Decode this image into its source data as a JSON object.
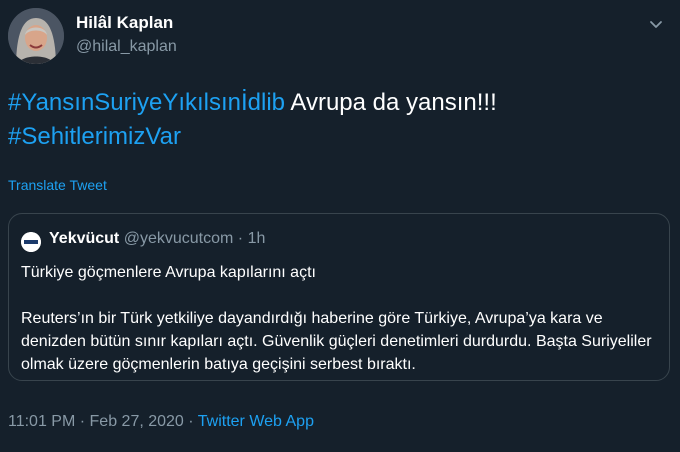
{
  "author": {
    "name": "Hilâl Kaplan",
    "handle": "@hilal_kaplan"
  },
  "tweet": {
    "hashtag1": "#YansınSuriyeYıkılsınİdlib",
    "text": " Avrupa da yansın!!!",
    "hashtag2": "#SehitlerimizVar"
  },
  "translate_label": "Translate Tweet",
  "quote": {
    "name": "Yekvücut",
    "handle": "@yekvucutcom",
    "separator": "·",
    "time": "1h",
    "headline": "Türkiye göçmenlere Avrupa kapılarını açtı",
    "body": "Reuters’ın bir Türk yetkiliye dayandırdığı haberine göre Türkiye, Avrupa’ya kara ve denizden bütün sınır kapıları açtı. Güvenlik güçleri denetimleri durdurdu. Başta Suriyeliler olmak üzere göçmenlerin batıya geçişini serbest bıraktı."
  },
  "footer": {
    "time": "11:01 PM",
    "sep1": "·",
    "date": "Feb 27, 2020",
    "sep2": "·",
    "source": "Twitter Web App"
  },
  "icons": {
    "menu": "chevron-down-icon",
    "avatar": "avatar",
    "quote_avatar": "yekvucut-logo"
  },
  "colors": {
    "background": "#15202b",
    "link": "#1da1f2",
    "muted": "#8899a6",
    "border": "#38444d"
  }
}
